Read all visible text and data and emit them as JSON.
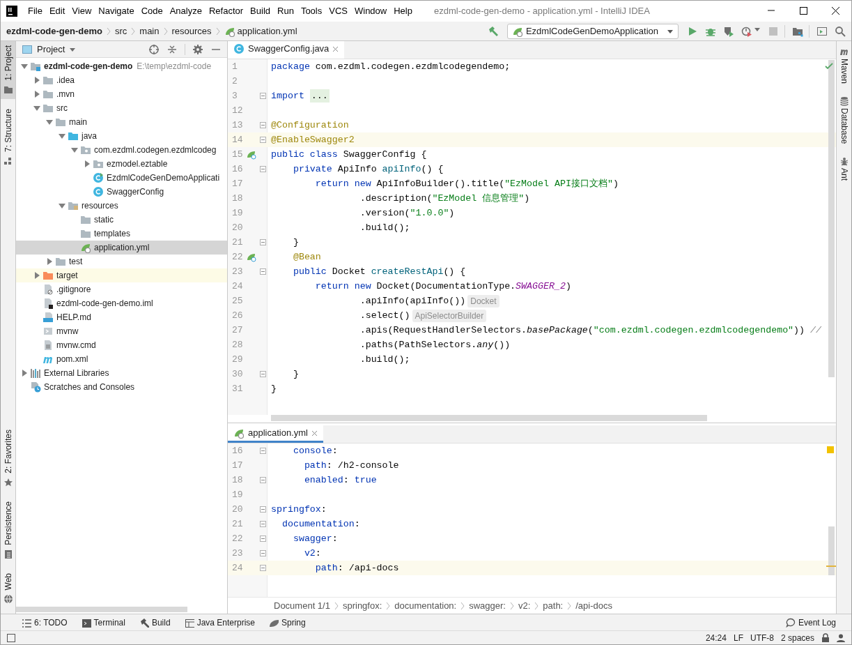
{
  "window": {
    "title": "ezdml-code-gen-demo - application.yml - IntelliJ IDEA"
  },
  "menu": [
    "File",
    "Edit",
    "View",
    "Navigate",
    "Code",
    "Analyze",
    "Refactor",
    "Build",
    "Run",
    "Tools",
    "VCS",
    "Window",
    "Help"
  ],
  "navigation": {
    "breadcrumb": [
      "ezdml-code-gen-demo",
      "src",
      "main",
      "resources",
      "application.yml"
    ]
  },
  "run_configuration": {
    "label": "EzdmlCodeGenDemoApplication"
  },
  "left_strip": {
    "top": [
      {
        "label": "1: Project",
        "selected": true
      },
      {
        "label": "7: Structure",
        "selected": false
      }
    ],
    "bottom": [
      {
        "label": "2: Favorites",
        "selected": false
      },
      {
        "label": "Persistence",
        "selected": false
      },
      {
        "label": "Web",
        "selected": false
      }
    ]
  },
  "project_panel": {
    "title": "Project",
    "tree": [
      {
        "label": "ezdml-code-gen-demo",
        "path": "E:\\temp\\ezdml-code",
        "kind": "module",
        "expanded": true,
        "selected": false,
        "children": [
          {
            "label": ".idea",
            "kind": "folder",
            "expanded": false,
            "selected": false
          },
          {
            "label": ".mvn",
            "kind": "folder",
            "expanded": false,
            "selected": false
          },
          {
            "label": "src",
            "kind": "folder",
            "expanded": true,
            "selected": false,
            "children": [
              {
                "label": "main",
                "kind": "folder",
                "expanded": true,
                "selected": false,
                "children": [
                  {
                    "label": "java",
                    "kind": "source-folder",
                    "expanded": true,
                    "selected": false,
                    "children": [
                      {
                        "label": "com.ezdml.codegen.ezdmlcodeg",
                        "kind": "package",
                        "expanded": true,
                        "selected": false,
                        "children": [
                          {
                            "label": "ezmodel.eztable",
                            "kind": "package",
                            "expanded": false,
                            "selected": false
                          },
                          {
                            "label": "EzdmlCodeGenDemoApplicati",
                            "kind": "spring-class",
                            "selected": false
                          },
                          {
                            "label": "SwaggerConfig",
                            "kind": "class",
                            "selected": false
                          }
                        ]
                      }
                    ]
                  },
                  {
                    "label": "resources",
                    "kind": "resources-folder",
                    "expanded": true,
                    "selected": false,
                    "children": [
                      {
                        "label": "static",
                        "kind": "folder",
                        "selected": false
                      },
                      {
                        "label": "templates",
                        "kind": "folder",
                        "selected": false
                      },
                      {
                        "label": "application.yml",
                        "kind": "yml",
                        "selected": true
                      }
                    ]
                  }
                ]
              },
              {
                "label": "test",
                "kind": "folder",
                "expanded": false,
                "selected": false
              }
            ]
          },
          {
            "label": "target",
            "kind": "excluded-folder",
            "expanded": false,
            "selected": false
          },
          {
            "label": ".gitignore",
            "kind": "ignore-file",
            "selected": false
          },
          {
            "label": "ezdml-code-gen-demo.iml",
            "kind": "module-file",
            "selected": false
          },
          {
            "label": "HELP.md",
            "kind": "markdown",
            "selected": false
          },
          {
            "label": "mvnw",
            "kind": "script",
            "selected": false
          },
          {
            "label": "mvnw.cmd",
            "kind": "text-file",
            "selected": false
          },
          {
            "label": "pom.xml",
            "kind": "maven",
            "selected": false
          }
        ]
      },
      {
        "label": "External Libraries",
        "kind": "libraries",
        "expanded": false,
        "selected": false
      },
      {
        "label": "Scratches and Consoles",
        "kind": "scratches",
        "selected": false
      }
    ]
  },
  "editor": {
    "upper": {
      "tab": {
        "label": "SwaggerConfig.java",
        "kind": "class",
        "selected": false
      },
      "lines": [
        {
          "n": "1",
          "kind": "plain",
          "tokens": [
            {
              "kind": "kw",
              "text": "package"
            },
            {
              "kind": "p",
              "text": " com.ezdml.codegen.ezdmlcodegendemo;"
            }
          ]
        },
        {
          "n": "2",
          "kind": "plain"
        },
        {
          "n": "3",
          "kind": "fold",
          "tokens": [
            {
              "kind": "kw",
              "text": "import "
            },
            {
              "kind": "folded",
              "text": "..."
            }
          ]
        },
        {
          "n": "12",
          "kind": "plain"
        },
        {
          "n": "13",
          "kind": "fold",
          "tokens": [
            {
              "kind": "ann",
              "text": "@Configuration"
            }
          ]
        },
        {
          "n": "14",
          "kind": "fold",
          "current": true,
          "tokens": [
            {
              "kind": "ann",
              "text": "@EnableSwagger2"
            }
          ]
        },
        {
          "n": "15",
          "kind": "bean",
          "tokens": [
            {
              "kind": "kw",
              "text": "public class "
            },
            {
              "kind": "p",
              "text": "SwaggerConfig {"
            }
          ]
        },
        {
          "n": "16",
          "kind": "fold",
          "tokens": [
            {
              "kind": "kw",
              "text": "    private "
            },
            {
              "kind": "p",
              "text": "ApiInfo "
            },
            {
              "kind": "fn",
              "text": "apiInfo"
            },
            {
              "kind": "p",
              "text": "() {"
            }
          ]
        },
        {
          "n": "17",
          "kind": "plain",
          "tokens": [
            {
              "kind": "kw",
              "text": "        return new "
            },
            {
              "kind": "p",
              "text": "ApiInfoBuilder().title("
            },
            {
              "kind": "str",
              "text": "\"EzModel API接口文档\""
            },
            {
              "kind": "p",
              "text": ")"
            }
          ]
        },
        {
          "n": "18",
          "kind": "plain",
          "tokens": [
            {
              "kind": "p",
              "text": "                .description("
            },
            {
              "kind": "str",
              "text": "\"EzModel 信息管理\""
            },
            {
              "kind": "p",
              "text": ")"
            }
          ]
        },
        {
          "n": "19",
          "kind": "plain",
          "tokens": [
            {
              "kind": "p",
              "text": "                .version("
            },
            {
              "kind": "str",
              "text": "\"1.0.0\""
            },
            {
              "kind": "p",
              "text": ")"
            }
          ]
        },
        {
          "n": "20",
          "kind": "plain",
          "tokens": [
            {
              "kind": "p",
              "text": "                .build();"
            }
          ]
        },
        {
          "n": "21",
          "kind": "fold",
          "tokens": [
            {
              "kind": "p",
              "text": "    }"
            }
          ]
        },
        {
          "n": "22",
          "kind": "bean",
          "tokens": [
            {
              "kind": "ann",
              "text": "    @Bean"
            }
          ]
        },
        {
          "n": "23",
          "kind": "fold",
          "tokens": [
            {
              "kind": "kw",
              "text": "    public "
            },
            {
              "kind": "p",
              "text": "Docket "
            },
            {
              "kind": "fn",
              "text": "createRestApi"
            },
            {
              "kind": "p",
              "text": "() {"
            }
          ]
        },
        {
          "n": "24",
          "kind": "plain",
          "tokens": [
            {
              "kind": "kw",
              "text": "        return new "
            },
            {
              "kind": "p",
              "text": "Docket(DocumentationType."
            },
            {
              "kind": "static",
              "text": "SWAGGER_2"
            },
            {
              "kind": "p",
              "text": ")"
            }
          ]
        },
        {
          "n": "25",
          "kind": "plain",
          "tokens": [
            {
              "kind": "p",
              "text": "                .apiInfo(apiInfo())"
            },
            {
              "kind": "hint",
              "text": "Docket"
            }
          ]
        },
        {
          "n": "26",
          "kind": "plain",
          "tokens": [
            {
              "kind": "p",
              "text": "                .select()"
            },
            {
              "kind": "hint",
              "text": "ApiSelectorBuilder"
            }
          ]
        },
        {
          "n": "27",
          "kind": "plain",
          "tokens": [
            {
              "kind": "p",
              "text": "                .apis(RequestHandlerSelectors."
            },
            {
              "kind": "it",
              "text": "basePackage"
            },
            {
              "kind": "p",
              "text": "("
            },
            {
              "kind": "str",
              "text": "\"com.ezdml.codegen.ezdmlcodegendemo\""
            },
            {
              "kind": "p",
              "text": ")) "
            },
            {
              "kind": "cm",
              "text": "//"
            }
          ]
        },
        {
          "n": "28",
          "kind": "plain",
          "tokens": [
            {
              "kind": "p",
              "text": "                .paths(PathSelectors."
            },
            {
              "kind": "it",
              "text": "any"
            },
            {
              "kind": "p",
              "text": "())"
            }
          ]
        },
        {
          "n": "29",
          "kind": "plain",
          "tokens": [
            {
              "kind": "p",
              "text": "                .build();"
            }
          ]
        },
        {
          "n": "30",
          "kind": "fold",
          "tokens": [
            {
              "kind": "p",
              "text": "    }"
            }
          ]
        },
        {
          "n": "31",
          "kind": "plain",
          "tokens": [
            {
              "kind": "p",
              "text": "}"
            }
          ]
        }
      ]
    },
    "lower": {
      "tab": {
        "label": "application.yml",
        "kind": "yml",
        "selected": true
      },
      "lines": [
        {
          "n": "16",
          "kind": "fold",
          "tokens": [
            {
              "kind": "key",
              "text": "    console"
            },
            {
              "kind": "p",
              "text": ":"
            }
          ]
        },
        {
          "n": "17",
          "kind": "plain",
          "tokens": [
            {
              "kind": "key",
              "text": "      path"
            },
            {
              "kind": "p",
              "text": ": /h2-console"
            }
          ]
        },
        {
          "n": "18",
          "kind": "fold",
          "tokens": [
            {
              "kind": "key",
              "text": "      enabled"
            },
            {
              "kind": "p",
              "text": ": "
            },
            {
              "kind": "kw",
              "text": "true"
            }
          ]
        },
        {
          "n": "19",
          "kind": "plain"
        },
        {
          "n": "20",
          "kind": "fold",
          "tokens": [
            {
              "kind": "key",
              "text": "springfox"
            },
            {
              "kind": "p",
              "text": ":"
            }
          ]
        },
        {
          "n": "21",
          "kind": "fold",
          "tokens": [
            {
              "kind": "key",
              "text": "  documentation"
            },
            {
              "kind": "p",
              "text": ":"
            }
          ]
        },
        {
          "n": "22",
          "kind": "fold",
          "tokens": [
            {
              "kind": "key",
              "text": "    swagger"
            },
            {
              "kind": "p",
              "text": ":"
            }
          ]
        },
        {
          "n": "23",
          "kind": "fold",
          "tokens": [
            {
              "kind": "key",
              "text": "      v2"
            },
            {
              "kind": "p",
              "text": ":"
            }
          ]
        },
        {
          "n": "24",
          "kind": "fold",
          "current": true,
          "tokens": [
            {
              "kind": "key",
              "text": "        path"
            },
            {
              "kind": "p",
              "text": ": /api-docs"
            }
          ]
        }
      ],
      "breadcrumb": [
        "Document 1/1",
        "springfox:",
        "documentation:",
        "swagger:",
        "v2:",
        "path:",
        "/api-docs"
      ]
    }
  },
  "right_strip": [
    {
      "label": "Maven"
    },
    {
      "label": "Database"
    },
    {
      "label": "Ant"
    }
  ],
  "tool_windows": [
    "6: TODO",
    "Terminal",
    "Build",
    "Java Enterprise",
    "Spring"
  ],
  "event_log": "Event Log",
  "status_bar": {
    "position": "24:24",
    "line_separator": "LF",
    "encoding": "UTF-8",
    "indent": "2 spaces"
  }
}
